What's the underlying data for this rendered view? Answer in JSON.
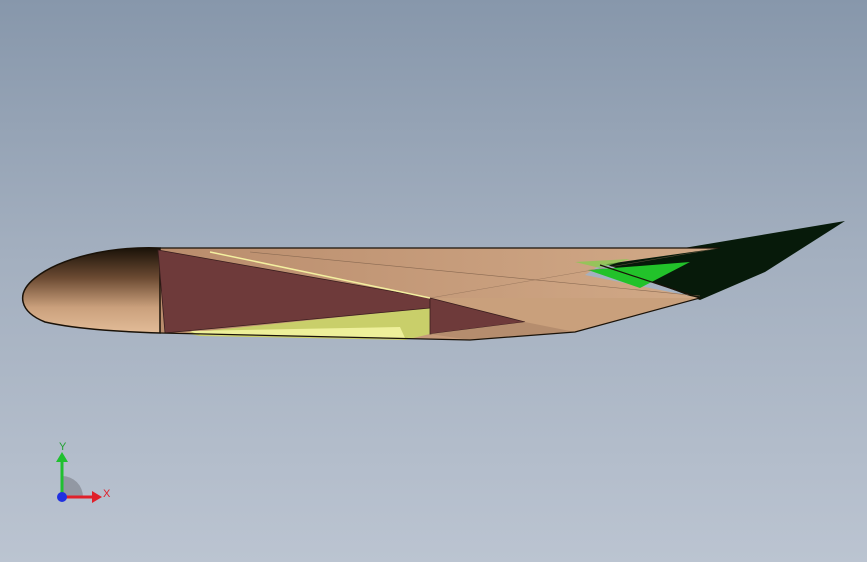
{
  "viewport": {
    "background_top": "#8797ab",
    "background_bottom": "#bbc4d1"
  },
  "model": {
    "colors": {
      "nose_dark": "#1a1208",
      "nose_light": "#d9b08c",
      "skin": "#c49a7a",
      "skin_light": "#d2aa88",
      "inlet": "#6e3a3a",
      "inlet_dark": "#5a2e2e",
      "channel": "#c9cf6a",
      "channel_light": "#eef09a",
      "tail_dark": "#071a0a",
      "tail_green": "#22c22a"
    }
  },
  "triad": {
    "x_label": "X",
    "y_label": "Y",
    "x_color": "#e0202a",
    "y_color": "#20c030",
    "origin_color": "#2030e0",
    "icon": "coordinate-triad-icon"
  }
}
